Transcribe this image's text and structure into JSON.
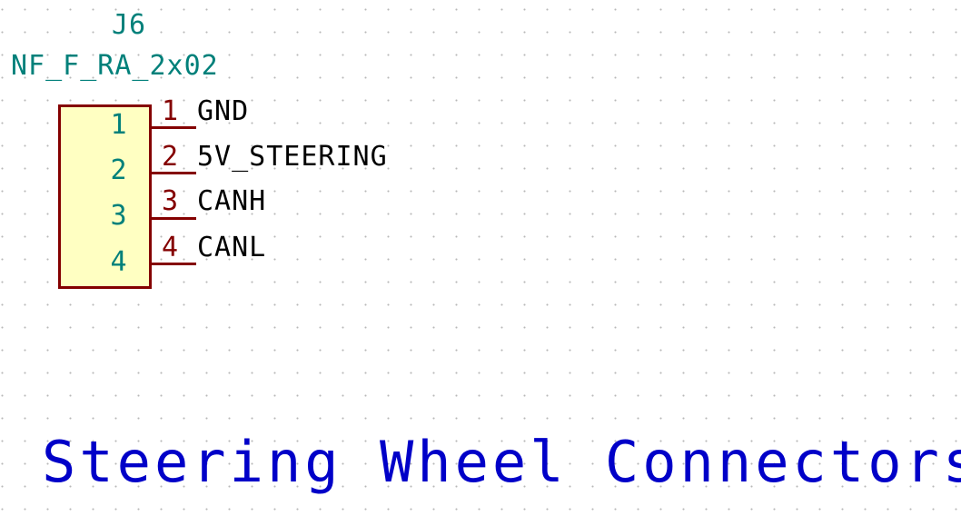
{
  "component": {
    "reference": "J6",
    "value": "NF_F_RA_2x02",
    "pins": [
      {
        "inner": "1",
        "number": "1",
        "net": "GND"
      },
      {
        "inner": "2",
        "number": "2",
        "net": "5V_STEERING"
      },
      {
        "inner": "3",
        "number": "3",
        "net": "CANH"
      },
      {
        "inner": "4",
        "number": "4",
        "net": "CANL"
      }
    ]
  },
  "sheet": {
    "title": "Steering Wheel Connectors"
  },
  "colors": {
    "background": "#ffffff",
    "grid_dot": "#b8b8b8",
    "component_text": "#00807a",
    "pin_line": "#840000",
    "body_fill": "#ffffc2",
    "net_label": "#000000",
    "title_text": "#0000c8"
  }
}
